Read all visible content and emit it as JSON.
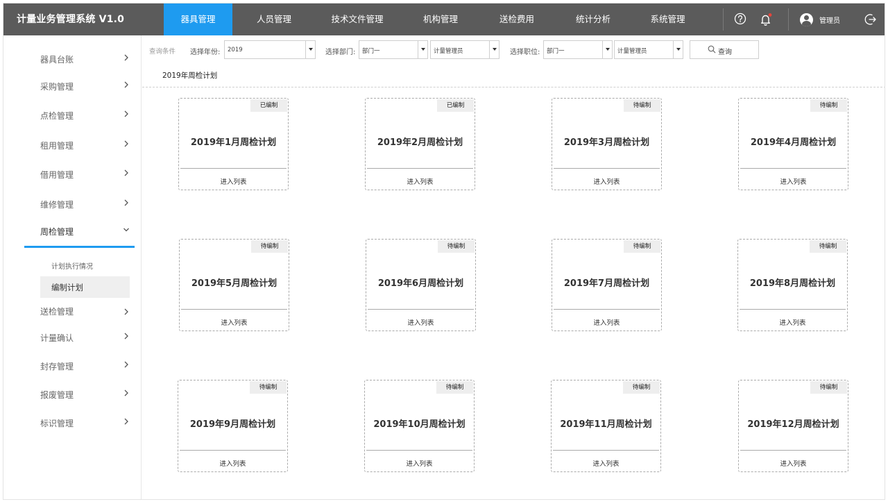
{
  "app": {
    "title": "计量业务管理系统 V1.0"
  },
  "topnav": {
    "items": [
      {
        "label": "器具管理",
        "active": true
      },
      {
        "label": "人员管理"
      },
      {
        "label": "技术文件管理"
      },
      {
        "label": "机构管理"
      },
      {
        "label": "送检费用"
      },
      {
        "label": "统计分析"
      },
      {
        "label": "系统管理"
      }
    ],
    "icons": [
      "help-icon",
      "bell-icon",
      "logout-icon"
    ],
    "notification_dot_color": "#e8453c",
    "user": {
      "name": "管理员"
    }
  },
  "sidebar": {
    "items": [
      {
        "label": "器具台账"
      },
      {
        "label": "采购管理"
      },
      {
        "label": "点检管理"
      },
      {
        "label": "租用管理"
      },
      {
        "label": "借用管理"
      },
      {
        "label": "维修管理"
      },
      {
        "label": "周检管理",
        "expanded": true
      },
      {
        "label": "送检管理"
      },
      {
        "label": "计量确认"
      },
      {
        "label": "封存管理"
      },
      {
        "label": "报废管理"
      },
      {
        "label": "标识管理"
      }
    ],
    "subitems": [
      {
        "label": "计划执行情况"
      },
      {
        "label": "编制计划",
        "selected": true
      }
    ]
  },
  "filters": {
    "section_label": "查询条件",
    "year_label": "选择年份:",
    "year_value": "2019",
    "dept_label": "选择部门:",
    "dept_value": "部门一",
    "dept_role_value": "计量管理员",
    "position_label": "选择职位:",
    "position_value": "部门一",
    "position_role_value": "计量管理员",
    "query_label": "查询"
  },
  "section": {
    "title": "2019年周检计划"
  },
  "cards": [
    {
      "title": "2019年1月周检计划",
      "status": "已编制",
      "link": "进入列表"
    },
    {
      "title": "2019年2月周检计划",
      "status": "已编制",
      "link": "进入列表"
    },
    {
      "title": "2019年3月周检计划",
      "status": "待编制",
      "link": "进入列表"
    },
    {
      "title": "2019年4月周检计划",
      "status": "待编制",
      "link": "进入列表"
    },
    {
      "title": "2019年5月周检计划",
      "status": "待编制",
      "link": "进入列表"
    },
    {
      "title": "2019年6月周检计划",
      "status": "待编制",
      "link": "进入列表"
    },
    {
      "title": "2019年7月周检计划",
      "status": "待编制",
      "link": "进入列表"
    },
    {
      "title": "2019年8月周检计划",
      "status": "待编制",
      "link": "进入列表"
    },
    {
      "title": "2019年9月周检计划",
      "status": "待编制",
      "link": "进入列表"
    },
    {
      "title": "2019年10月周检计划",
      "status": "待编制",
      "link": "进入列表"
    },
    {
      "title": "2019年11月周检计划",
      "status": "待编制",
      "link": "进入列表"
    },
    {
      "title": "2019年12月周检计划",
      "status": "待编制",
      "link": "进入列表"
    }
  ],
  "colors": {
    "topbar": "#5b5b5b",
    "accent": "#1e9bf0",
    "badge_bg": "#eeeeee"
  }
}
